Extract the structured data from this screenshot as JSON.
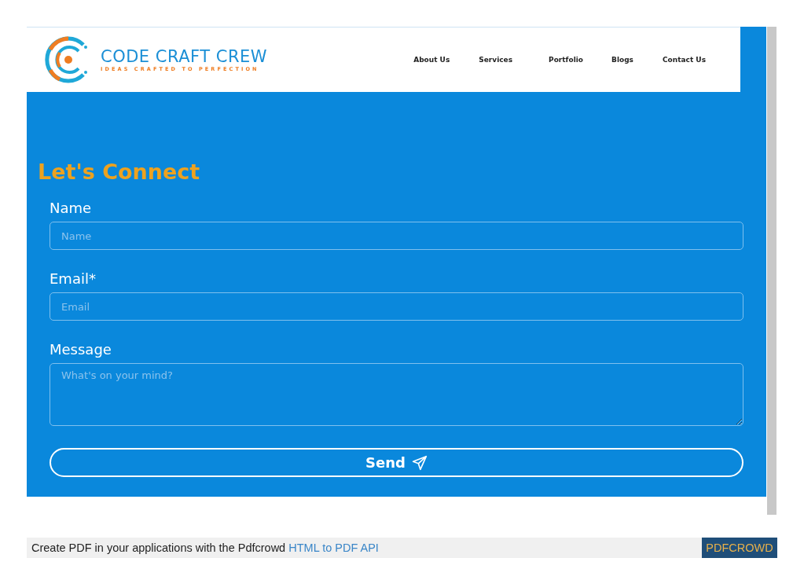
{
  "header": {
    "logo": {
      "name": "CODE CRAFT CREW",
      "tagline": "IDEAS CRAFTED TO PERFECTION"
    },
    "nav": [
      "About Us",
      "Services",
      "Portfolio",
      "Blogs",
      "Contact Us"
    ]
  },
  "contact": {
    "title": "Let's Connect",
    "fields": [
      {
        "kind": "input",
        "label": "Name",
        "placeholder": "Name"
      },
      {
        "kind": "input",
        "label": "Email*",
        "placeholder": "Email"
      },
      {
        "kind": "textarea",
        "label": "Message",
        "placeholder": "What's on your mind?"
      }
    ],
    "submit": "Send"
  },
  "footer": {
    "text": "Create PDF in your applications with the Pdfcrowd",
    "link": "HTML to PDF API",
    "badge": "PDFCROWD"
  }
}
